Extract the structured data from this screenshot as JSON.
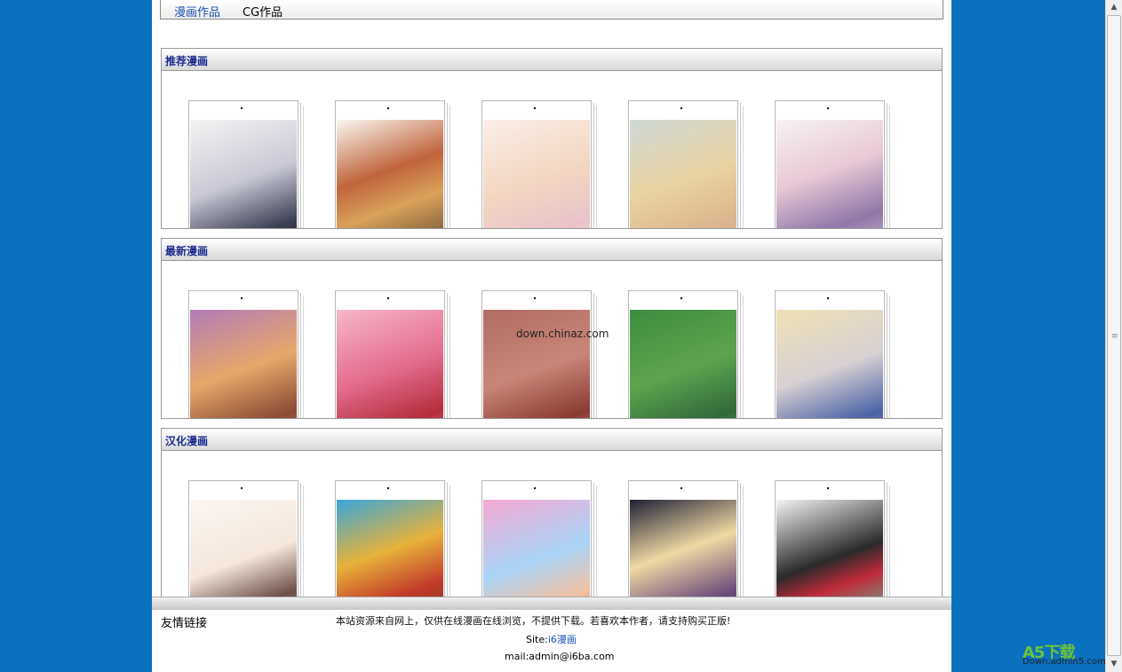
{
  "nav": {
    "tab1": "漫画作品",
    "tab2": "CG作品"
  },
  "sections": [
    {
      "title": "推荐漫画",
      "cards": [
        "g1",
        "g2",
        "g3",
        "g4",
        "g5"
      ]
    },
    {
      "title": "最新漫画",
      "cards": [
        "h1",
        "h2",
        "h3",
        "h4",
        "h5"
      ]
    },
    {
      "title": "汉化漫画",
      "cards": [
        "k1",
        "k2",
        "k3",
        "k4",
        "k5"
      ]
    }
  ],
  "watermark": "down.chinaz.com",
  "footer": {
    "friend_links": "友情链接",
    "note": "本站资源来自网上，仅供在线漫画在线浏览，不提供下载。若喜欢本作者，请支持购买正版!",
    "site_label": "Site:",
    "site_link": "i6漫画",
    "mail": "mail:admin@i6ba.com"
  },
  "logo": {
    "main": "A5下载",
    "sub": "Down.admin5.com"
  }
}
